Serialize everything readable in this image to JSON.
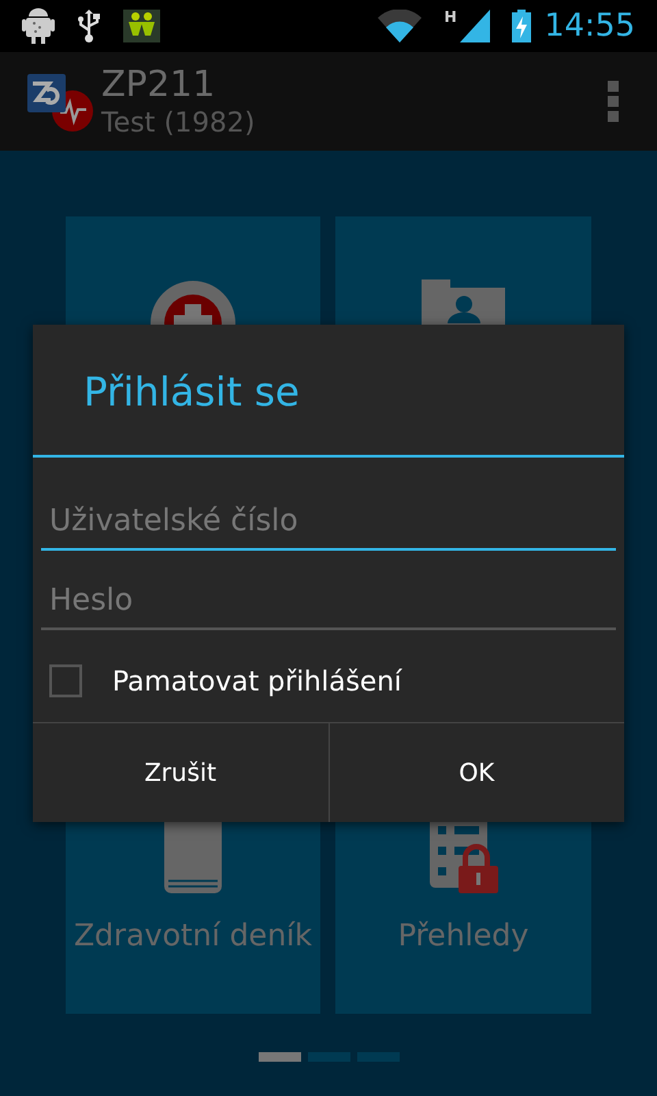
{
  "status_bar": {
    "network_type": "H",
    "time": "14:55"
  },
  "action_bar": {
    "title": "ZP211",
    "subtitle": "Test (1982)"
  },
  "tiles": [
    {
      "kind": "emergency"
    },
    {
      "kind": "contacts"
    },
    {
      "kind": "diary",
      "label": "Zdravotní deník"
    },
    {
      "kind": "reports",
      "label": "Přehledy"
    }
  ],
  "page_indicator": [
    {
      "selected": true
    },
    {
      "selected": false
    },
    {
      "selected": false
    }
  ],
  "dialog": {
    "title": "Přihlásit se",
    "fields": [
      {
        "placeholder": "Uživatelské číslo",
        "focused": true
      },
      {
        "placeholder": "Heslo",
        "focused": false
      }
    ],
    "checkbox": {
      "label": "Pamatovat přihlášení",
      "checked": false
    },
    "buttons": [
      "Zrušit",
      "OK"
    ]
  }
}
